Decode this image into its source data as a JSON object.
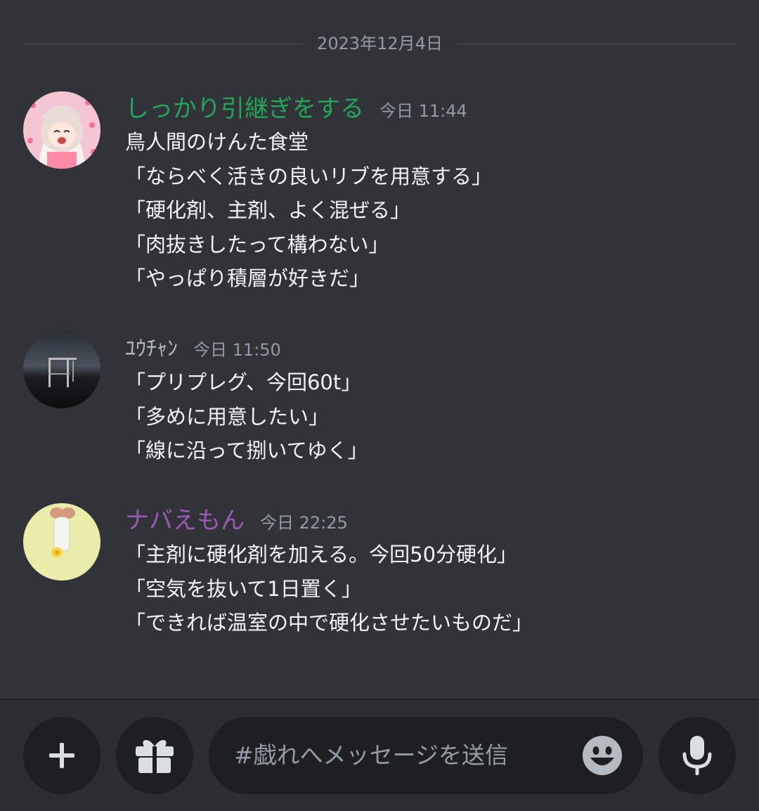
{
  "date_divider": "2023年12月4日",
  "messages": [
    {
      "username": "しっかり引継ぎをする",
      "username_color": "#23a55a",
      "timestamp": "今日 11:44",
      "lines": [
        "鳥人間のけんた食堂",
        "「ならべく活きの良いリブを用意する」",
        "「硬化剤、主剤、よく混ぜる」",
        "「肉抜きしたって構わない」",
        "「やっぱり積層が好きだ」"
      ]
    },
    {
      "username": "ﾕｳﾁｬﾝ",
      "username_color": "#b5bac1",
      "timestamp": "今日 11:50",
      "lines": [
        "「プリプレグ、今回60t」",
        "「多めに用意したい」",
        "「線に沿って捌いてゆく」"
      ]
    },
    {
      "username": "ナバえもん",
      "username_color": "#9b59b6",
      "timestamp": "今日 22:25",
      "lines": [
        "「主剤に硬化剤を加える。今回50分硬化」",
        "「空気を抜いて1日置く」",
        "「できれば温室の中で硬化させたいものだ」"
      ]
    }
  ],
  "composer": {
    "placeholder": "#戯れへメッセージを送信",
    "icons": [
      "plus-icon",
      "gift-icon",
      "emoji-icon",
      "microphone-icon"
    ]
  }
}
